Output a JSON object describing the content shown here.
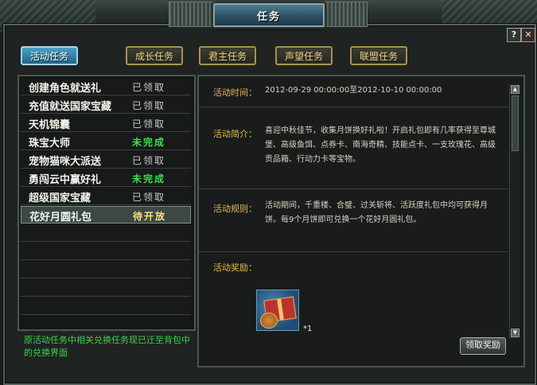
{
  "window": {
    "title": "任务",
    "help_label": "?",
    "close_label": "✕"
  },
  "tabs": [
    {
      "label": "活动任务",
      "active": true
    },
    {
      "label": "成长任务",
      "active": false
    },
    {
      "label": "君主任务",
      "active": false
    },
    {
      "label": "声望任务",
      "active": false
    },
    {
      "label": "联盟任务",
      "active": false
    }
  ],
  "task_list": [
    {
      "name": "创建角色就送礼",
      "status": "已领取",
      "state": "done"
    },
    {
      "name": "充值就送国家宝藏",
      "status": "已领取",
      "state": "done"
    },
    {
      "name": "天机锦囊",
      "status": "已领取",
      "state": "done"
    },
    {
      "name": "珠宝大师",
      "status": "未完成",
      "state": "undone"
    },
    {
      "name": "宠物猫咪大派送",
      "status": "已领取",
      "state": "done"
    },
    {
      "name": "勇闯云中赢好礼",
      "status": "未完成",
      "state": "undone"
    },
    {
      "name": "超级国家宝藏",
      "status": "已领取",
      "state": "done"
    },
    {
      "name": "花好月圆礼包",
      "status": "待开放",
      "state": "pending"
    }
  ],
  "left_note": "原活动任务中相关兑换任务现已迁至背包中的兑换界面",
  "detail": {
    "time_label": "活动时间：",
    "time_value": "2012-09-29 00:00:00至2012-10-10 00:00:00",
    "intro_label": "活动简介：",
    "intro_value": "喜迎中秋佳节，收集月饼换好礼啦！开启礼包即有几率获得至尊城堡、高级鱼饵、点券卡、南海奇精、技能点卡、一支玫瑰花、高级贡品箱、行动力卡等宝物。",
    "rules_label": "活动规则：",
    "rules_value": "活动期间，千重楼、合璧、过关斩将、活跃度礼包中均可获得月饼。每9个月饼即可兑换一个花好月圆礼包。",
    "reward_label": "活动奖励：",
    "reward_icon": "mooncake-gift-icon",
    "reward_count": "*1",
    "claim_label": "领取奖励"
  },
  "colors": {
    "label_gold": "#e2b94e",
    "status_undone": "#39e04a",
    "status_pending": "#ffe27a",
    "note_green": "#3ed24c",
    "active_tab": "#2f86b0"
  }
}
